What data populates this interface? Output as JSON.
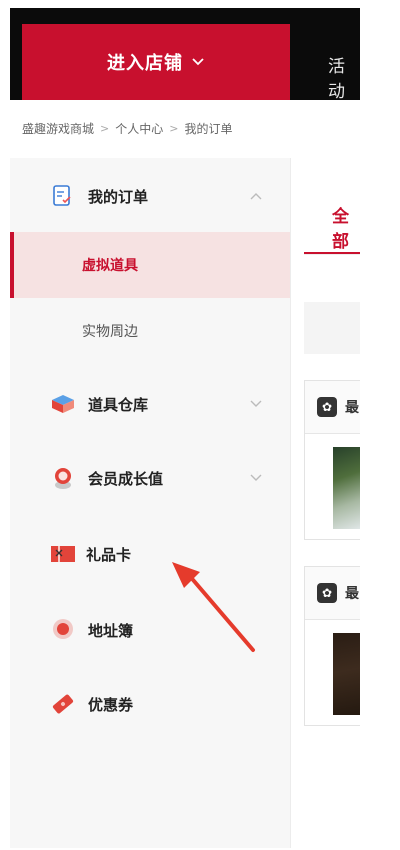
{
  "header": {
    "enter_store": "进入店铺",
    "activity_label": "活动"
  },
  "breadcrumb": {
    "items": [
      "盛趣游戏商城",
      "个人中心",
      "我的订单"
    ],
    "separator": ">"
  },
  "sidebar": {
    "my_orders": "我的订单",
    "virtual_items": "虚拟道具",
    "physical_merch": "实物周边",
    "item_warehouse": "道具仓库",
    "member_growth": "会员成长值",
    "gift_card": "礼品卡",
    "address_book": "地址簿",
    "coupons": "优惠券"
  },
  "main": {
    "tab_all": "全部",
    "order_prefix": "最"
  },
  "colors": {
    "accent": "#c8102e",
    "topbar": "#0b0b0b",
    "active_bg": "#f6e2e2"
  },
  "icons": {
    "orders": "receipt-icon",
    "warehouse": "box-icon",
    "member": "medal-icon",
    "gift": "gift-card-icon",
    "address": "location-pin-icon",
    "coupon": "ticket-icon"
  }
}
